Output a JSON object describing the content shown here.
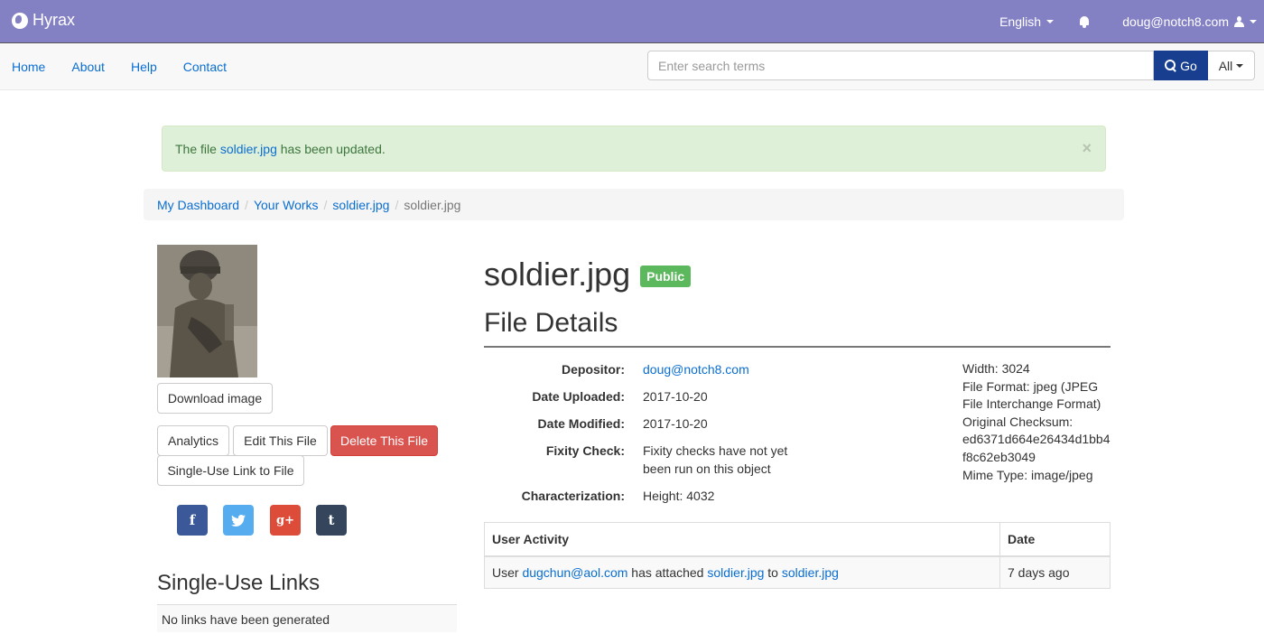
{
  "topbar": {
    "brand": "Hyrax",
    "language": "English",
    "user_email": "doug@notch8.com",
    "bg_color": "#8380c4"
  },
  "nav": {
    "links": [
      "Home",
      "About",
      "Help",
      "Contact"
    ],
    "search_placeholder": "Enter search terms",
    "go_label": "Go",
    "scope_label": "All"
  },
  "alert": {
    "prefix": "The file ",
    "link": "soldier.jpg",
    "suffix": " has been updated.",
    "close": "×"
  },
  "breadcrumb": {
    "items": [
      "My Dashboard",
      "Your Works",
      "soldier.jpg"
    ],
    "active": "soldier.jpg"
  },
  "actions": {
    "download": "Download image",
    "analytics": "Analytics",
    "edit": "Edit This File",
    "delete": "Delete This File",
    "single_use": "Single-Use Link to File"
  },
  "share": {
    "facebook": "f",
    "twitter": "twitter-icon",
    "google": "g+",
    "tumblr": "t",
    "colors": {
      "facebook": "#3b5998",
      "twitter": "#55acee",
      "google": "#dd4b39",
      "tumblr": "#35465c"
    }
  },
  "single_use_links": {
    "title": "Single-Use Links",
    "empty": "No links have been generated"
  },
  "file": {
    "title": "soldier.jpg",
    "visibility": "Public",
    "section": "File Details",
    "depositor_label": "Depositor:",
    "depositor": "doug@notch8.com",
    "uploaded_label": "Date Uploaded:",
    "uploaded": "2017-10-20",
    "modified_label": "Date Modified:",
    "modified": "2017-10-20",
    "fixity_label": "Fixity Check:",
    "fixity_line1": "Fixity checks have not yet",
    "fixity_line2": "been run on this object",
    "characterization_label": "Characterization:",
    "height": "Height: 4032",
    "width": "Width: 3024",
    "format_line1": "File Format: jpeg (JPEG",
    "format_line2": "File Interchange Format)",
    "checksum_label": "Original Checksum:",
    "checksum_line1": "ed6371d664e26434d1bb4",
    "checksum_line2": "f8c62eb3049",
    "mime": "Mime Type: image/jpeg"
  },
  "activity": {
    "headers": [
      "User Activity",
      "Date"
    ],
    "row": {
      "user_prefix": "User ",
      "user": "dugchun@aol.com",
      "mid": " has attached ",
      "file": "soldier.jpg",
      "to": " to ",
      "work": "soldier.jpg",
      "date": "7 days ago"
    }
  }
}
